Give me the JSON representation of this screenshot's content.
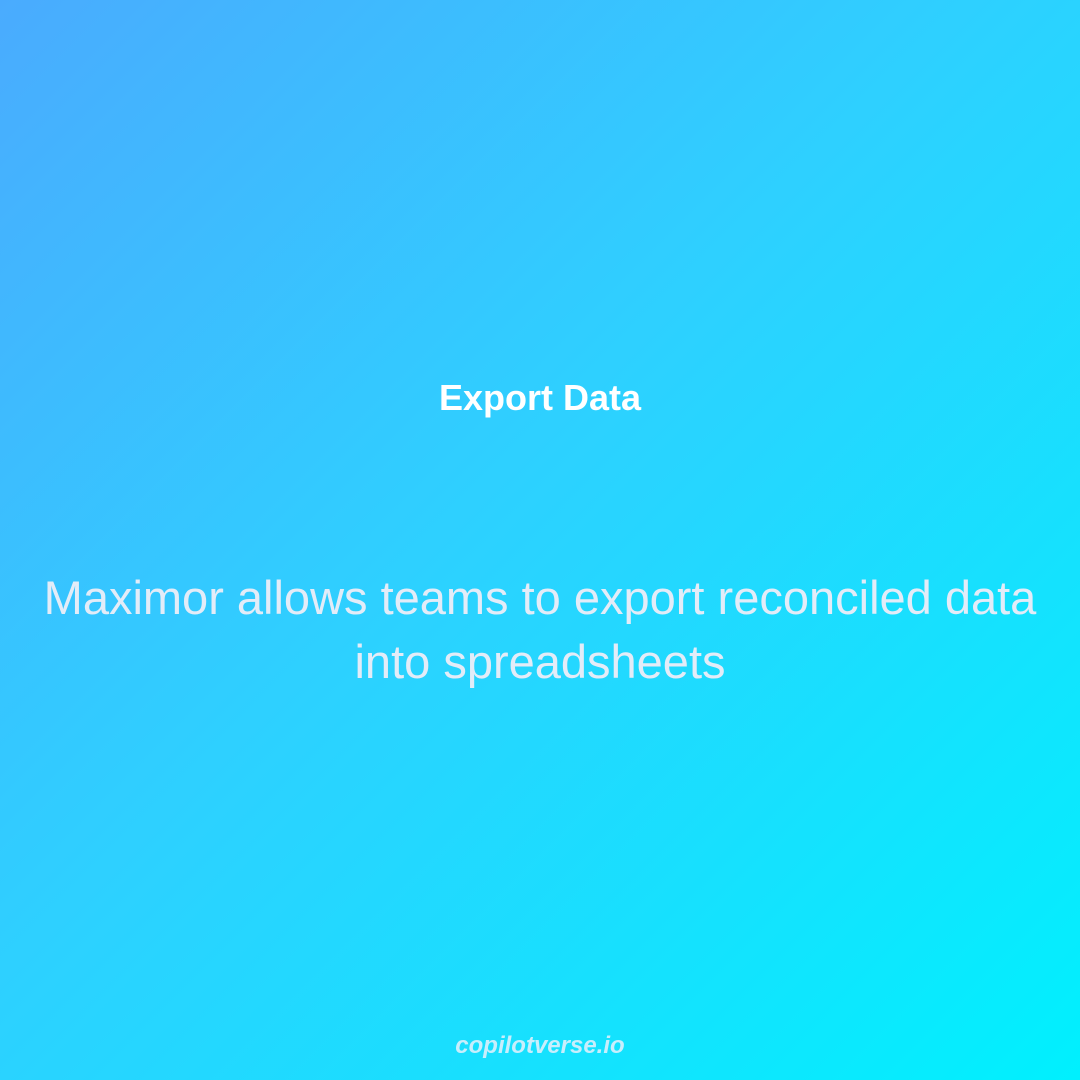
{
  "slide": {
    "title": "Export Data",
    "body": "Maximor allows teams to export reconciled data into spreadsheets",
    "footer": "copilotverse.io"
  },
  "colors": {
    "gradient_start": "#4aabfe",
    "gradient_end": "#00f0fe",
    "title": "#ffffff",
    "body": "#e3ecf8",
    "footer": "#c8eefc"
  }
}
